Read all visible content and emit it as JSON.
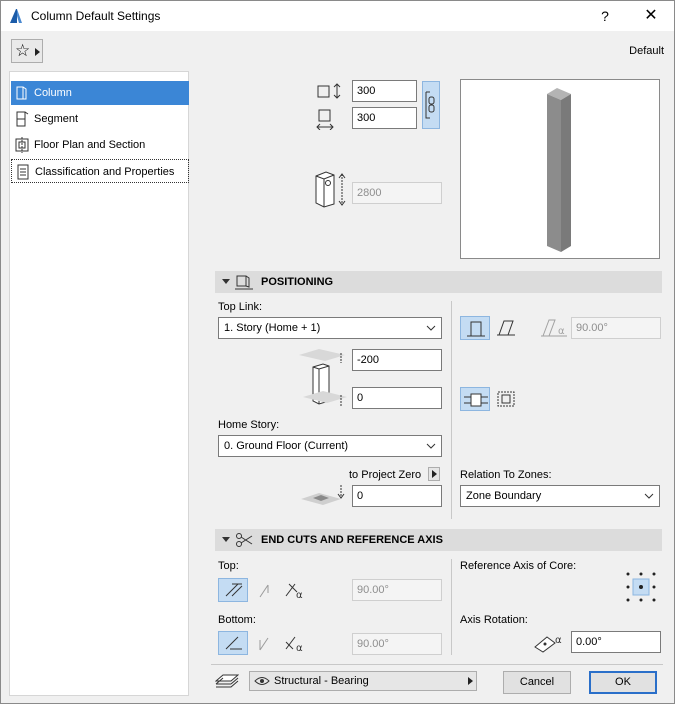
{
  "window": {
    "title": "Column Default Settings",
    "help_label": "?",
    "close_label": "✕",
    "favorite_label": "☆",
    "default_label": "Default"
  },
  "nav": {
    "items": [
      {
        "label": "Column",
        "icon": "column-icon"
      },
      {
        "label": "Segment",
        "icon": "segment-icon"
      },
      {
        "label": "Floor Plan and Section",
        "icon": "floor-plan-icon"
      },
      {
        "label": "Classification and Properties",
        "icon": "classification-icon"
      }
    ]
  },
  "geometry": {
    "width_value": "300",
    "depth_value": "300",
    "height_value": "2800"
  },
  "positioning": {
    "header": "POSITIONING",
    "top_link_label": "Top Link:",
    "top_link_value": "1. Story (Home + 1)",
    "top_offset_value": "-200",
    "bottom_offset_value": "0",
    "home_story_label": "Home Story:",
    "home_story_value": "0. Ground Floor (Current)",
    "to_project_zero_label": "to Project Zero",
    "project_zero_value": "0",
    "slant_angle_value": "90.00°",
    "relation_label": "Relation To Zones:",
    "relation_value": "Zone Boundary"
  },
  "end_cuts": {
    "header": "END CUTS AND REFERENCE AXIS",
    "top_label": "Top:",
    "top_angle_value": "90.00°",
    "bottom_label": "Bottom:",
    "bottom_angle_value": "90.00°",
    "ref_axis_label": "Reference Axis of Core:",
    "axis_rotation_label": "Axis Rotation:",
    "axis_rotation_value": "0.00°"
  },
  "footer": {
    "structural_value": "Structural - Bearing",
    "cancel_label": "Cancel",
    "ok_label": "OK"
  },
  "colors": {
    "selection": "#3b86d6",
    "primary_border": "#2a6fc9",
    "column_preview": "#8c8c8c"
  }
}
